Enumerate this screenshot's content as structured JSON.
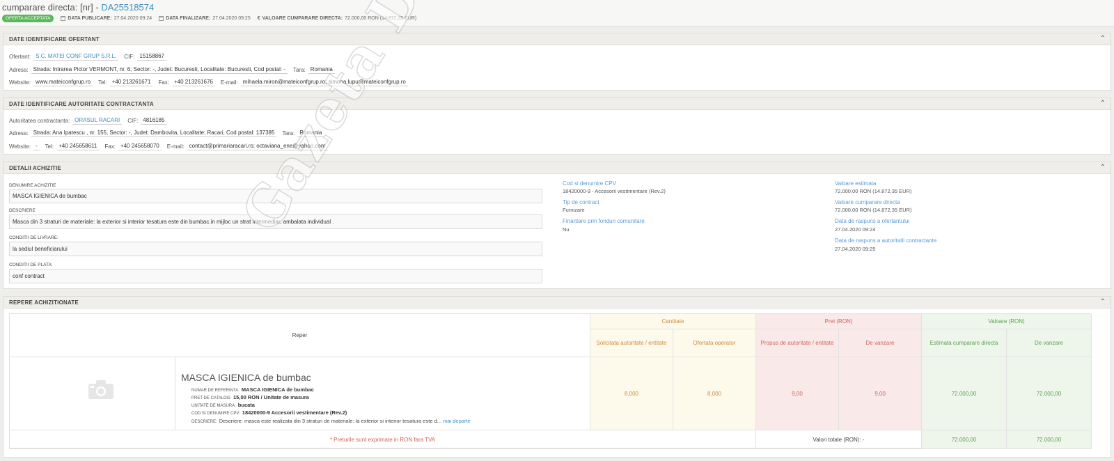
{
  "header": {
    "title_prefix": "cumparare directa: [nr] - ",
    "code": "DA25518574",
    "status": "OFERTA ACCEPTATA",
    "data_publicare_label": "DATA PUBLICARE:",
    "data_publicare": "27.04.2020 09:24",
    "data_finalizare_label": "DATA FINALIZARE:",
    "data_finalizare": "27.04.2020 09:25",
    "valoare_label": "VALOARE CUMPARARE DIRECTA:",
    "valoare_icon": "€",
    "valoare": "72.000,00  RON (14.872,35  EUR)"
  },
  "ofertant": {
    "title": "DATE IDENTIFICARE OFERTANT",
    "ofertant_label": "Ofertant:",
    "ofertant": "S.C. MATEI CONF GRUP S.R.L.",
    "cif_label": "CIF:",
    "cif": "15158867",
    "adresa_label": "Adresa:",
    "adresa": "Strada: Intrarea Pictor VERMONT, nr. 6, Sector: -, Judet: Bucuresti, Localitate: Bucuresti, Cod postal: -",
    "tara_label": "Tara:",
    "tara": "Romania",
    "website_label": "Website:",
    "website": "www.mateiconfgrup.ro",
    "tel_label": "Tel:",
    "tel": "+40 213261671",
    "fax_label": "Fax:",
    "fax": "+40 213261676",
    "email_label": "E-mail:",
    "email": "mihaela.miron@mateiconfgrup.ro; simona.lupu@mateiconfgrup.ro"
  },
  "autoritate": {
    "title": "DATE IDENTIFICARE AUTORITATE CONTRACTANTA",
    "autoritate_label": "Autoritatea contractanta:",
    "autoritate": "ORASUL RACARI",
    "cif_label": "CIF:",
    "cif": "4816185",
    "adresa_label": "Adresa:",
    "adresa": "Strada: Ana Ipatescu , nr. 155, Sector: -, Judet: Dambovita, Localitate: Racari, Cod postal: 137385",
    "tara_label": "Tara:",
    "tara": "Romania",
    "website_label": "Website:",
    "website": "-",
    "tel_label": "Tel:",
    "tel": "+40 245658611",
    "fax_label": "Fax:",
    "fax": "+40 245658070",
    "email_label": "E-mail:",
    "email": "contact@primariaracari.ro; octaviana_ene@yahoo.com"
  },
  "detalii": {
    "title": "DETALII ACHIZITIE",
    "denumire_label": "DENUMIRE ACHIZITIE",
    "denumire": "MASCA IGIENICA de bumbac",
    "descriere_label": "DESCRIERE",
    "descriere": "Masca din 3 straturi de materiale: la exterior si interior tesatura este din bumbac.in mijloc un strat intermediar, ambalata individual .",
    "livrare_label": "CONDITII DE LIVRARE:",
    "livrare": "la sediul beneficiarului",
    "plata_label": "CONDITII DE PLATA:",
    "plata": "conf contract",
    "cpv_label": "Cod si denumire CPV",
    "cpv": "18420000-9 - Accesorii vestimentare (Rev.2)",
    "tip_label": "Tip de contract",
    "tip": "Furnizare",
    "fonduri_label": "Finantare prin fonduri comunitare",
    "fonduri": "Nu",
    "val_est_label": "Valoare estimata",
    "val_est": "72.000,00  RON (14.872,35  EUR)",
    "val_cd_label": "Valoare cumparare directa",
    "val_cd": "72.000,00  RON (14.872,35  EUR)",
    "rasp_ofertant_label": "Data de raspuns a ofertantului",
    "rasp_ofertant": "27.04.2020 09:24",
    "rasp_autoritate_label": "Data de raspuns a autoritatii contractante",
    "rasp_autoritate": "27.04.2020 09:25"
  },
  "repere": {
    "title": "REPERE ACHIZITIONATE",
    "col_reper": "Reper",
    "grp_cantitate": "Cantitate",
    "grp_pret": "Pret (RON)",
    "grp_valoare": "Valoare (RON)",
    "col_solicitata": "Solicitata autoritate / entitate",
    "col_ofertata": "Ofertata operator",
    "col_propus": "Propus de autoritate / entitate",
    "col_vanzare": "De vanzare",
    "col_estimata": "Estimata cumparare directa",
    "col_val_vanzare": "De vanzare",
    "product_name": "MASCA IGIENICA de bumbac",
    "ref_label": "NUMAR DE REFERINTA:",
    "ref": "MASCA IGIENICA de bumbac",
    "pret_label": "PRET DE CATALOG:",
    "pret": "15,00  RON / Unitate de masura",
    "um_label": "UNITATE DE MASURA:",
    "um": "bucata",
    "cpv_label": "COD SI DENUMIRE CPV:",
    "cpv": "18420000-9 Accesorii vestimentare (Rev.2)",
    "desc_label": "DESCRIERE:",
    "desc": "Descriere: masca este realizata din 3 straturi de materiale: la exterior si interior tesatura este d...",
    "mai_departe": "mai departe",
    "solicitata": "8,000",
    "ofertata": "8,000",
    "propus": "9,00",
    "vanzare": "9,00",
    "estimata": "72.000,00",
    "val_vanzare": "72.000,00",
    "footnote": "* Preturile sunt exprimate in RON fara TVA",
    "totals_label": "Valori totale (RON): -",
    "total_estimata": "72.000,00",
    "total_vanzare": "72.000,00"
  },
  "watermark": "Gazeta Dâmboviței.ro",
  "icons": {
    "collapse": "chevron-up-icon",
    "calendar": "calendar-icon",
    "camera": "camera-icon"
  }
}
